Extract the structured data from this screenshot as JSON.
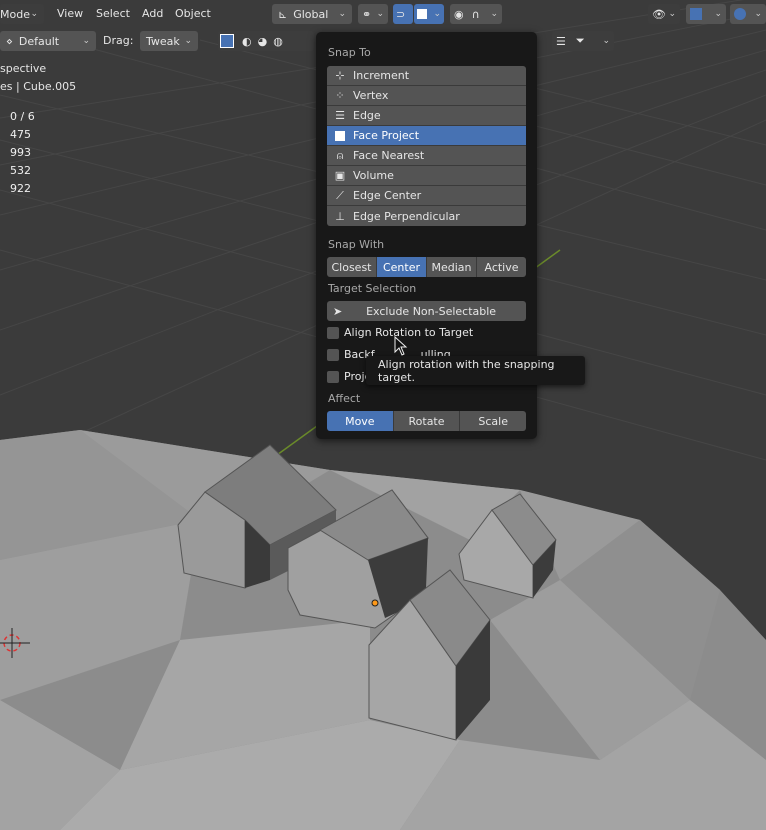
{
  "header": {
    "mode_label": "Mode",
    "menus": [
      "View",
      "Select",
      "Add",
      "Object"
    ],
    "orientation": "Global",
    "pivot_default": "Default",
    "drag_label": "Drag:",
    "drag_value": "Tweak"
  },
  "overlay": {
    "view_name": "spective",
    "object_info": "es | Cube.005",
    "stats": [
      "0 / 6",
      "475",
      "993",
      "532",
      "922"
    ]
  },
  "popup": {
    "snap_to_label": "Snap To",
    "snap_to_items": [
      {
        "label": "Increment",
        "icon": "increment-icon"
      },
      {
        "label": "Vertex",
        "icon": "vertex-icon"
      },
      {
        "label": "Edge",
        "icon": "edge-icon"
      },
      {
        "label": "Face Project",
        "icon": "face-project-icon",
        "selected": true
      },
      {
        "label": "Face Nearest",
        "icon": "face-nearest-icon"
      },
      {
        "label": "Volume",
        "icon": "volume-icon"
      },
      {
        "label": "Edge Center",
        "icon": "edge-center-icon"
      },
      {
        "label": "Edge Perpendicular",
        "icon": "edge-perpendicular-icon"
      }
    ],
    "snap_with_label": "Snap With",
    "snap_with": [
      "Closest",
      "Center",
      "Median",
      "Active"
    ],
    "snap_with_active": "Center",
    "target_selection_label": "Target Selection",
    "exclude_label": "Exclude Non-Selectable",
    "align_rotation_label": "Align Rotation to Target",
    "backface_partial": "Backf",
    "backface_partial_tail": "ulling",
    "project_partial": "Proje",
    "affect_label": "Affect",
    "affect": [
      "Move",
      "Rotate",
      "Scale"
    ],
    "affect_active": "Move"
  },
  "tooltip": {
    "text": "Align rotation with the snapping target."
  },
  "colors": {
    "accent": "#4772b3",
    "panel": "#181818",
    "button": "#545454",
    "viewport_bg": "#3d3d3d"
  }
}
